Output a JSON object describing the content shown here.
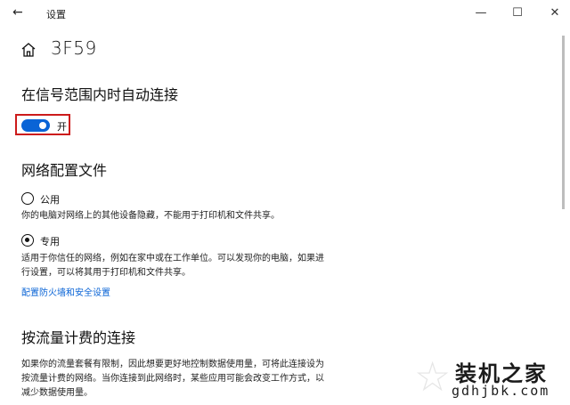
{
  "window": {
    "title": "设置",
    "back_icon": "←",
    "minimize_icon": "—",
    "maximize_icon": "☐",
    "close_icon": "✕"
  },
  "page": {
    "title": "3F59",
    "home_icon": "home-icon"
  },
  "auto_connect": {
    "heading": "在信号范围内时自动连接",
    "toggle_state": "开",
    "toggle_on": true,
    "toggle_color": "#0a64d6",
    "highlight_color": "#cc1b1b"
  },
  "network_profile": {
    "heading": "网络配置文件",
    "options": [
      {
        "label": "公用",
        "selected": false,
        "description": "你的电脑对网络上的其他设备隐藏，不能用于打印机和文件共享。"
      },
      {
        "label": "专用",
        "selected": true,
        "description": "适用于你信任的网络，例如在家中或在工作单位。可以发现你的电脑，如果进行设置，可以将其用于打印机和文件共享。"
      }
    ],
    "firewall_link": "配置防火墙和安全设置"
  },
  "metered": {
    "heading": "按流量计费的连接",
    "description": "如果你的流量套餐有限制，因此想要更好地控制数据使用量，可将此连接设为按流量计费的网络。当你连接到此网络时，某些应用可能会改变工作方式，以减少数据使用量。"
  },
  "watermark": {
    "text": "装机之家",
    "url": "gdhjbk.com"
  }
}
